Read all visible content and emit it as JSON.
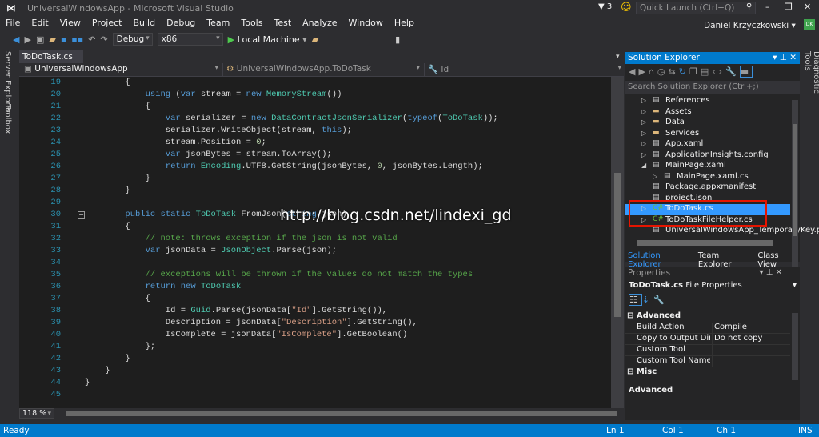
{
  "window": {
    "title": "UniversalWindowsApp - Microsoft Visual Studio",
    "notifications": "3",
    "quick_launch_placeholder": "Quick Launch (Ctrl+Q)",
    "user": "Daniel Krzyczkowski",
    "avatar": "DK"
  },
  "menu": [
    "File",
    "Edit",
    "View",
    "Project",
    "Build",
    "Debug",
    "Team",
    "Tools",
    "Test",
    "Analyze",
    "Window",
    "Help"
  ],
  "toolbar": {
    "config": "Debug",
    "platform": "x86",
    "run_target": "Local Machine"
  },
  "left_tabs": [
    "Server Explorer",
    "Toolbox"
  ],
  "right_tabs": [
    "Diagnostic Tools"
  ],
  "editor": {
    "tab": "ToDoTask.cs",
    "nav_project": "UniversalWindowsApp",
    "nav_type": "UniversalWindowsApp.ToDoTask",
    "nav_member": "Id",
    "zoom": "118 %",
    "lines": [
      {
        "n": "19",
        "indent": 2,
        "tokens": [
          [
            "p",
            "{"
          ]
        ]
      },
      {
        "n": "20",
        "indent": 3,
        "tokens": [
          [
            "k",
            "using"
          ],
          [
            "p",
            " ("
          ],
          [
            "k",
            "var"
          ],
          [
            "p",
            " stream = "
          ],
          [
            "k",
            "new"
          ],
          [
            "p",
            " "
          ],
          [
            "t",
            "MemoryStream"
          ],
          [
            "p",
            "())"
          ]
        ]
      },
      {
        "n": "21",
        "indent": 3,
        "tokens": [
          [
            "p",
            "{"
          ]
        ]
      },
      {
        "n": "22",
        "indent": 4,
        "tokens": [
          [
            "k",
            "var"
          ],
          [
            "p",
            " serializer = "
          ],
          [
            "k",
            "new"
          ],
          [
            "p",
            " "
          ],
          [
            "t",
            "DataContractJsonSerializer"
          ],
          [
            "p",
            "("
          ],
          [
            "k",
            "typeof"
          ],
          [
            "p",
            "("
          ],
          [
            "t",
            "ToDoTask"
          ],
          [
            "p",
            "));"
          ]
        ]
      },
      {
        "n": "23",
        "indent": 4,
        "tokens": [
          [
            "p",
            "serializer.WriteObject(stream, "
          ],
          [
            "k",
            "this"
          ],
          [
            "p",
            ");"
          ]
        ]
      },
      {
        "n": "24",
        "indent": 4,
        "tokens": [
          [
            "p",
            "stream.Position = "
          ],
          [
            "n",
            "0"
          ],
          [
            "p",
            ";"
          ]
        ]
      },
      {
        "n": "25",
        "indent": 4,
        "tokens": [
          [
            "k",
            "var"
          ],
          [
            "p",
            " jsonBytes = stream.ToArray();"
          ]
        ]
      },
      {
        "n": "26",
        "indent": 4,
        "tokens": [
          [
            "k",
            "return"
          ],
          [
            "p",
            " "
          ],
          [
            "t",
            "Encoding"
          ],
          [
            "p",
            ".UTF8.GetString(jsonBytes, "
          ],
          [
            "n",
            "0"
          ],
          [
            "p",
            ", jsonBytes.Length);"
          ]
        ]
      },
      {
        "n": "27",
        "indent": 3,
        "tokens": [
          [
            "p",
            "}"
          ]
        ]
      },
      {
        "n": "28",
        "indent": 2,
        "tokens": [
          [
            "p",
            "}"
          ]
        ]
      },
      {
        "n": "29",
        "indent": 0,
        "tokens": []
      },
      {
        "n": "30",
        "indent": 2,
        "tokens": [
          [
            "k",
            "public"
          ],
          [
            "p",
            " "
          ],
          [
            "k",
            "static"
          ],
          [
            "p",
            " "
          ],
          [
            "t",
            "ToDoTask"
          ],
          [
            "p",
            " FromJson("
          ],
          [
            "k",
            "string"
          ],
          [
            "p",
            " json)"
          ]
        ]
      },
      {
        "n": "31",
        "indent": 2,
        "tokens": [
          [
            "p",
            "{"
          ]
        ]
      },
      {
        "n": "32",
        "indent": 3,
        "tokens": [
          [
            "c",
            "// note: throws exception if the json is not valid"
          ]
        ]
      },
      {
        "n": "33",
        "indent": 3,
        "tokens": [
          [
            "k",
            "var"
          ],
          [
            "p",
            " jsonData = "
          ],
          [
            "t",
            "JsonObject"
          ],
          [
            "p",
            ".Parse(json);"
          ]
        ]
      },
      {
        "n": "34",
        "indent": 0,
        "tokens": []
      },
      {
        "n": "35",
        "indent": 3,
        "tokens": [
          [
            "c",
            "// exceptions will be thrown if the values do not match the types"
          ]
        ]
      },
      {
        "n": "36",
        "indent": 3,
        "tokens": [
          [
            "k",
            "return"
          ],
          [
            "p",
            " "
          ],
          [
            "k",
            "new"
          ],
          [
            "p",
            " "
          ],
          [
            "t",
            "ToDoTask"
          ]
        ]
      },
      {
        "n": "37",
        "indent": 3,
        "tokens": [
          [
            "p",
            "{"
          ]
        ]
      },
      {
        "n": "38",
        "indent": 4,
        "tokens": [
          [
            "p",
            "Id = "
          ],
          [
            "t",
            "Guid"
          ],
          [
            "p",
            ".Parse(jsonData["
          ],
          [
            "s",
            "\"Id\""
          ],
          [
            "p",
            "].GetString()),"
          ]
        ]
      },
      {
        "n": "39",
        "indent": 4,
        "tokens": [
          [
            "p",
            "Description = jsonData["
          ],
          [
            "s",
            "\"Description\""
          ],
          [
            "p",
            "].GetString(),"
          ]
        ]
      },
      {
        "n": "40",
        "indent": 4,
        "tokens": [
          [
            "p",
            "IsComplete = jsonData["
          ],
          [
            "s",
            "\"IsComplete\""
          ],
          [
            "p",
            "].GetBoolean()"
          ]
        ]
      },
      {
        "n": "41",
        "indent": 3,
        "tokens": [
          [
            "p",
            "};"
          ]
        ]
      },
      {
        "n": "42",
        "indent": 2,
        "tokens": [
          [
            "p",
            "}"
          ]
        ]
      },
      {
        "n": "43",
        "indent": 1,
        "tokens": [
          [
            "p",
            "}"
          ]
        ]
      },
      {
        "n": "44",
        "indent": 0,
        "tokens": [
          [
            "p",
            "}"
          ]
        ]
      },
      {
        "n": "45",
        "indent": 0,
        "tokens": []
      }
    ]
  },
  "watermark": "http://blog.csdn.net/lindexi_gd",
  "solution_explorer": {
    "title": "Solution Explorer",
    "search_placeholder": "Search Solution Explorer (Ctrl+;)",
    "items": [
      {
        "label": "References",
        "expander": "▷",
        "level": 0,
        "icon": "references-icon",
        "color": "#ccc"
      },
      {
        "label": "Assets",
        "expander": "▷",
        "level": 0,
        "icon": "folder-icon",
        "color": "#dcb67a"
      },
      {
        "label": "Data",
        "expander": "▷",
        "level": 0,
        "icon": "folder-icon",
        "color": "#dcb67a"
      },
      {
        "label": "Services",
        "expander": "▷",
        "level": 0,
        "icon": "folder-icon",
        "color": "#dcb67a"
      },
      {
        "label": "App.xaml",
        "expander": "▷",
        "level": 0,
        "icon": "xaml-icon",
        "color": "#ccc"
      },
      {
        "label": "ApplicationInsights.config",
        "expander": "▷",
        "level": 0,
        "icon": "config-icon",
        "color": "#ccc"
      },
      {
        "label": "MainPage.xaml",
        "expander": "◢",
        "level": 0,
        "icon": "xaml-icon",
        "color": "#ccc"
      },
      {
        "label": "MainPage.xaml.cs",
        "expander": "▷",
        "level": 1,
        "icon": "cs-file-icon",
        "color": "#ccc"
      },
      {
        "label": "Package.appxmanifest",
        "expander": "",
        "level": 0,
        "icon": "manifest-icon",
        "color": "#ccc"
      },
      {
        "label": "project.json",
        "expander": "",
        "level": 0,
        "icon": "json-icon",
        "color": "#ccc"
      },
      {
        "label": "ToDoTask.cs",
        "expander": "▷",
        "level": 0,
        "icon": "csharp-icon",
        "color": "#6bbf3c",
        "selected": true
      },
      {
        "label": "ToDoTaskFileHelper.cs",
        "expander": "▷",
        "level": 0,
        "icon": "csharp-icon",
        "color": "#6bbf3c"
      },
      {
        "label": "UniversalWindowsApp_TemporaryKey.pfx",
        "expander": "",
        "level": 0,
        "icon": "certificate-icon",
        "color": "#ccc"
      }
    ],
    "tabs": [
      "Solution Explorer",
      "Team Explorer",
      "Class View"
    ]
  },
  "properties": {
    "title": "Properties",
    "object": "ToDoTask.cs",
    "object_type": "File Properties",
    "categories": [
      {
        "name": "Advanced",
        "rows": [
          [
            "Build Action",
            "Compile"
          ],
          [
            "Copy to Output Directory",
            "Do not copy"
          ],
          [
            "Custom Tool",
            ""
          ],
          [
            "Custom Tool Namespace",
            ""
          ]
        ]
      },
      {
        "name": "Misc",
        "rows": []
      }
    ],
    "description_title": "Advanced"
  },
  "status": {
    "text": "Ready",
    "line": "Ln 1",
    "col": "Col 1",
    "ch": "Ch 1",
    "mode": "INS"
  },
  "colors": {
    "accent": "#007acc",
    "selection": "#3399ff",
    "highlight_box": "#e51400"
  }
}
